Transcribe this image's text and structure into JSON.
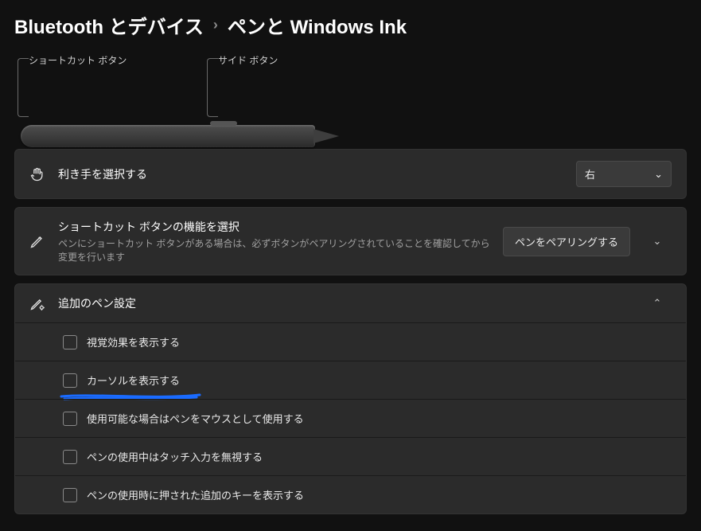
{
  "breadcrumb": {
    "parent": "Bluetooth とデバイス",
    "current": "ペンと Windows Ink"
  },
  "diagram": {
    "shortcut_button_label": "ショートカット ボタン",
    "side_button_label": "サイド ボタン"
  },
  "hand": {
    "title": "利き手を選択する",
    "value": "右"
  },
  "shortcut": {
    "title": "ショートカット ボタンの機能を選択",
    "desc": "ペンにショートカット ボタンがある場合は、必ずボタンがペアリングされていることを確認してから変更を行います",
    "pair_button": "ペンをペアリングする"
  },
  "additional": {
    "title": "追加のペン設定",
    "items": [
      {
        "label": "視覚効果を表示する"
      },
      {
        "label": "カーソルを表示する"
      },
      {
        "label": "使用可能な場合はペンをマウスとして使用する"
      },
      {
        "label": "ペンの使用中はタッチ入力を無視する"
      },
      {
        "label": "ペンの使用時に押された追加のキーを表示する"
      }
    ]
  }
}
